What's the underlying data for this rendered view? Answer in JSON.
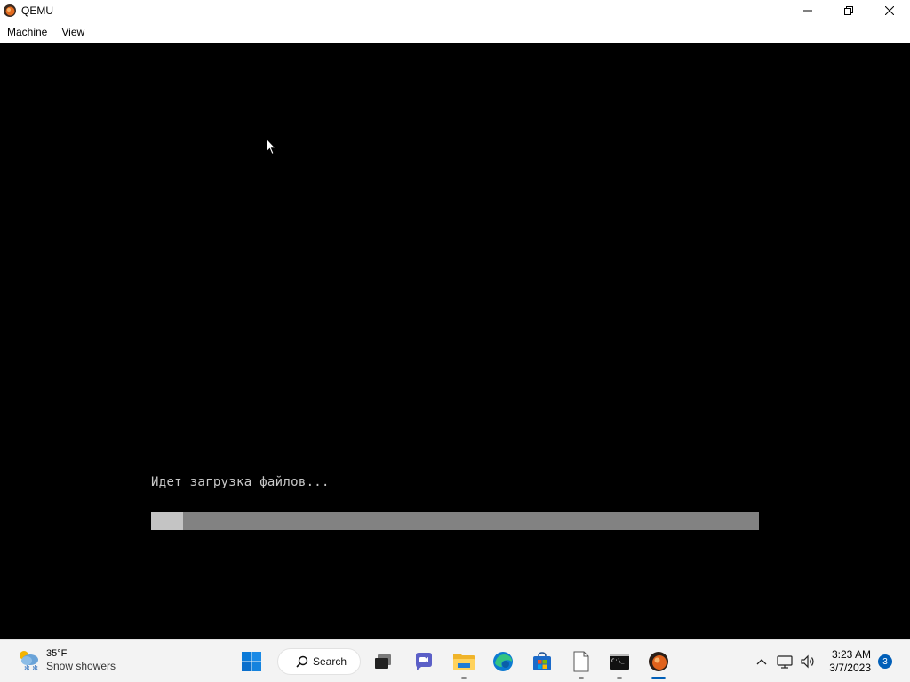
{
  "window": {
    "title": "QEMU",
    "controls": {
      "minimize": "minimize-icon",
      "restore": "restore-icon",
      "close": "close-icon"
    }
  },
  "menubar": {
    "items": [
      {
        "label": "Machine"
      },
      {
        "label": "View"
      }
    ]
  },
  "vm": {
    "boot_message": "Идет загрузка файлов...",
    "progress": {
      "fraction": 0.053
    },
    "colors": {
      "background": "#000000",
      "text": "#c8c8c8",
      "track": "#828282",
      "fill": "#c4c4c4"
    }
  },
  "taskbar": {
    "weather": {
      "temperature": "35°F",
      "description": "Snow showers",
      "icon": "weather-snow-icon"
    },
    "search": {
      "label": "Search"
    },
    "apps": [
      {
        "name": "start",
        "icon": "windows-start-icon",
        "running": false
      },
      {
        "name": "task-view",
        "icon": "task-view-icon",
        "running": false
      },
      {
        "name": "teams-chat",
        "icon": "chat-icon",
        "running": false
      },
      {
        "name": "file-explorer",
        "icon": "folder-icon",
        "running": true
      },
      {
        "name": "edge",
        "icon": "edge-icon",
        "running": false
      },
      {
        "name": "store",
        "icon": "store-icon",
        "running": false
      },
      {
        "name": "notepad",
        "icon": "file-icon",
        "running": true
      },
      {
        "name": "terminal",
        "icon": "terminal-icon",
        "running": true
      },
      {
        "name": "qemu",
        "icon": "qemu-icon",
        "running": true,
        "active": true
      }
    ],
    "tray": {
      "icons": [
        "chevron-up-icon",
        "network-icon",
        "volume-icon"
      ],
      "time": "3:23 AM",
      "date": "3/7/2023",
      "notifications": "3"
    },
    "accent": "#005fb8"
  }
}
